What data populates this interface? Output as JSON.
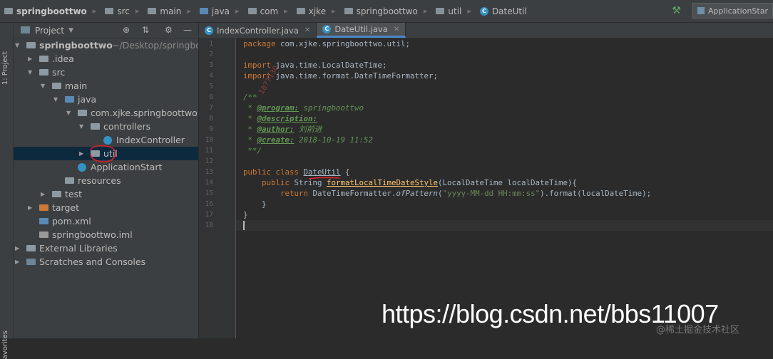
{
  "breadcrumbs": [
    {
      "label": "springboottwo",
      "icon": "folder-icon",
      "bold": true
    },
    {
      "label": "src",
      "icon": "folder-icon"
    },
    {
      "label": "main",
      "icon": "folder-icon"
    },
    {
      "label": "java",
      "icon": "folder-blue-icon"
    },
    {
      "label": "com",
      "icon": "package-icon"
    },
    {
      "label": "xjke",
      "icon": "package-icon"
    },
    {
      "label": "springboottwo",
      "icon": "package-icon"
    },
    {
      "label": "util",
      "icon": "package-icon"
    },
    {
      "label": "DateUtil",
      "icon": "class-icon"
    }
  ],
  "run_config": {
    "label": "ApplicationStar"
  },
  "side_strip": {
    "project_label": "1: Project",
    "favorites_label": "avorites"
  },
  "project_panel": {
    "title": "Project",
    "tree": [
      {
        "label": "springboottwo",
        "suffix": "~/Desktop/springbo",
        "arrow": "▼",
        "icon": "folder",
        "bold": true
      },
      {
        "label": ".idea",
        "arrow": "▶",
        "icon": "folder"
      },
      {
        "label": "src",
        "arrow": "▼",
        "icon": "folder"
      },
      {
        "label": "main",
        "arrow": "▼",
        "icon": "folder"
      },
      {
        "label": "java",
        "arrow": "▼",
        "icon": "folder-blue"
      },
      {
        "label": "com.xjke.springboottwo",
        "arrow": "▼",
        "icon": "package"
      },
      {
        "label": "controllers",
        "arrow": "▼",
        "icon": "package"
      },
      {
        "label": "IndexController",
        "arrow": "",
        "icon": "class"
      },
      {
        "label": "util",
        "arrow": "▶",
        "icon": "package",
        "selected": true
      },
      {
        "label": "ApplicationStart",
        "arrow": "",
        "icon": "class-run"
      },
      {
        "label": "resources",
        "arrow": "",
        "icon": "folder-res"
      },
      {
        "label": "test",
        "arrow": "▶",
        "icon": "folder"
      },
      {
        "label": "target",
        "arrow": "▶",
        "icon": "folder-orange"
      },
      {
        "label": "pom.xml",
        "arrow": "",
        "icon": "maven"
      },
      {
        "label": "springboottwo.iml",
        "arrow": "",
        "icon": "file"
      },
      {
        "label": "External Libraries",
        "arrow": "▶",
        "icon": "libs"
      },
      {
        "label": "Scratches and Consoles",
        "arrow": "▶",
        "icon": "scratch"
      }
    ]
  },
  "editor_tabs": [
    {
      "label": "IndexController.java",
      "active": false
    },
    {
      "label": "DateUtil.java",
      "active": true
    }
  ],
  "code": {
    "line_numbers": [
      "1",
      "2",
      "3",
      "4",
      "5",
      "6",
      "7",
      "8",
      "9",
      "10",
      "11",
      "12",
      "13",
      "14",
      "15",
      "16",
      "17",
      "18"
    ],
    "l1_kw": "package",
    "l1_rest": " com.xjke.springboottwo.util;",
    "l3_kw": "import",
    "l3_rest": " java.time.LocalDateTime;",
    "l4_kw": "import",
    "l4_rest": " java.time.format.DateTimeFormatter;",
    "l6": "/**",
    "l7_star": " * ",
    "l7_tag": "@program:",
    "l7_val": " springboottwo",
    "l8_star": " * ",
    "l8_tag": "@description:",
    "l9_star": " * ",
    "l9_tag": "@author:",
    "l9_val": " 刘前进",
    "l10_star": " * ",
    "l10_tag": "@create:",
    "l10_val": " 2018-10-19 11:52",
    "l11": " **/",
    "l13_kw": "public class",
    "l13_name": "DateUtil",
    "l13_rest": " {",
    "l14_kw": "    public",
    "l14_type": " String ",
    "l14_method": "formatLocalTimeDateStyle",
    "l14_rest": "(LocalDateTime localDateTime){",
    "l15_kw": "        return",
    "l15_a": " DateTimeFormatter.",
    "l15_method": "ofPattern",
    "l15_b": "(",
    "l15_str": "\"yyyy-MM-dd HH:mm:ss\"",
    "l15_c": ").format(localDateTime);",
    "l16": "    }",
    "l17": "}"
  },
  "watermark": "https://blog.csdn.net/bbs11007",
  "watermark_small": "@稀土掘金技术社区",
  "faint_mark": "1877130"
}
